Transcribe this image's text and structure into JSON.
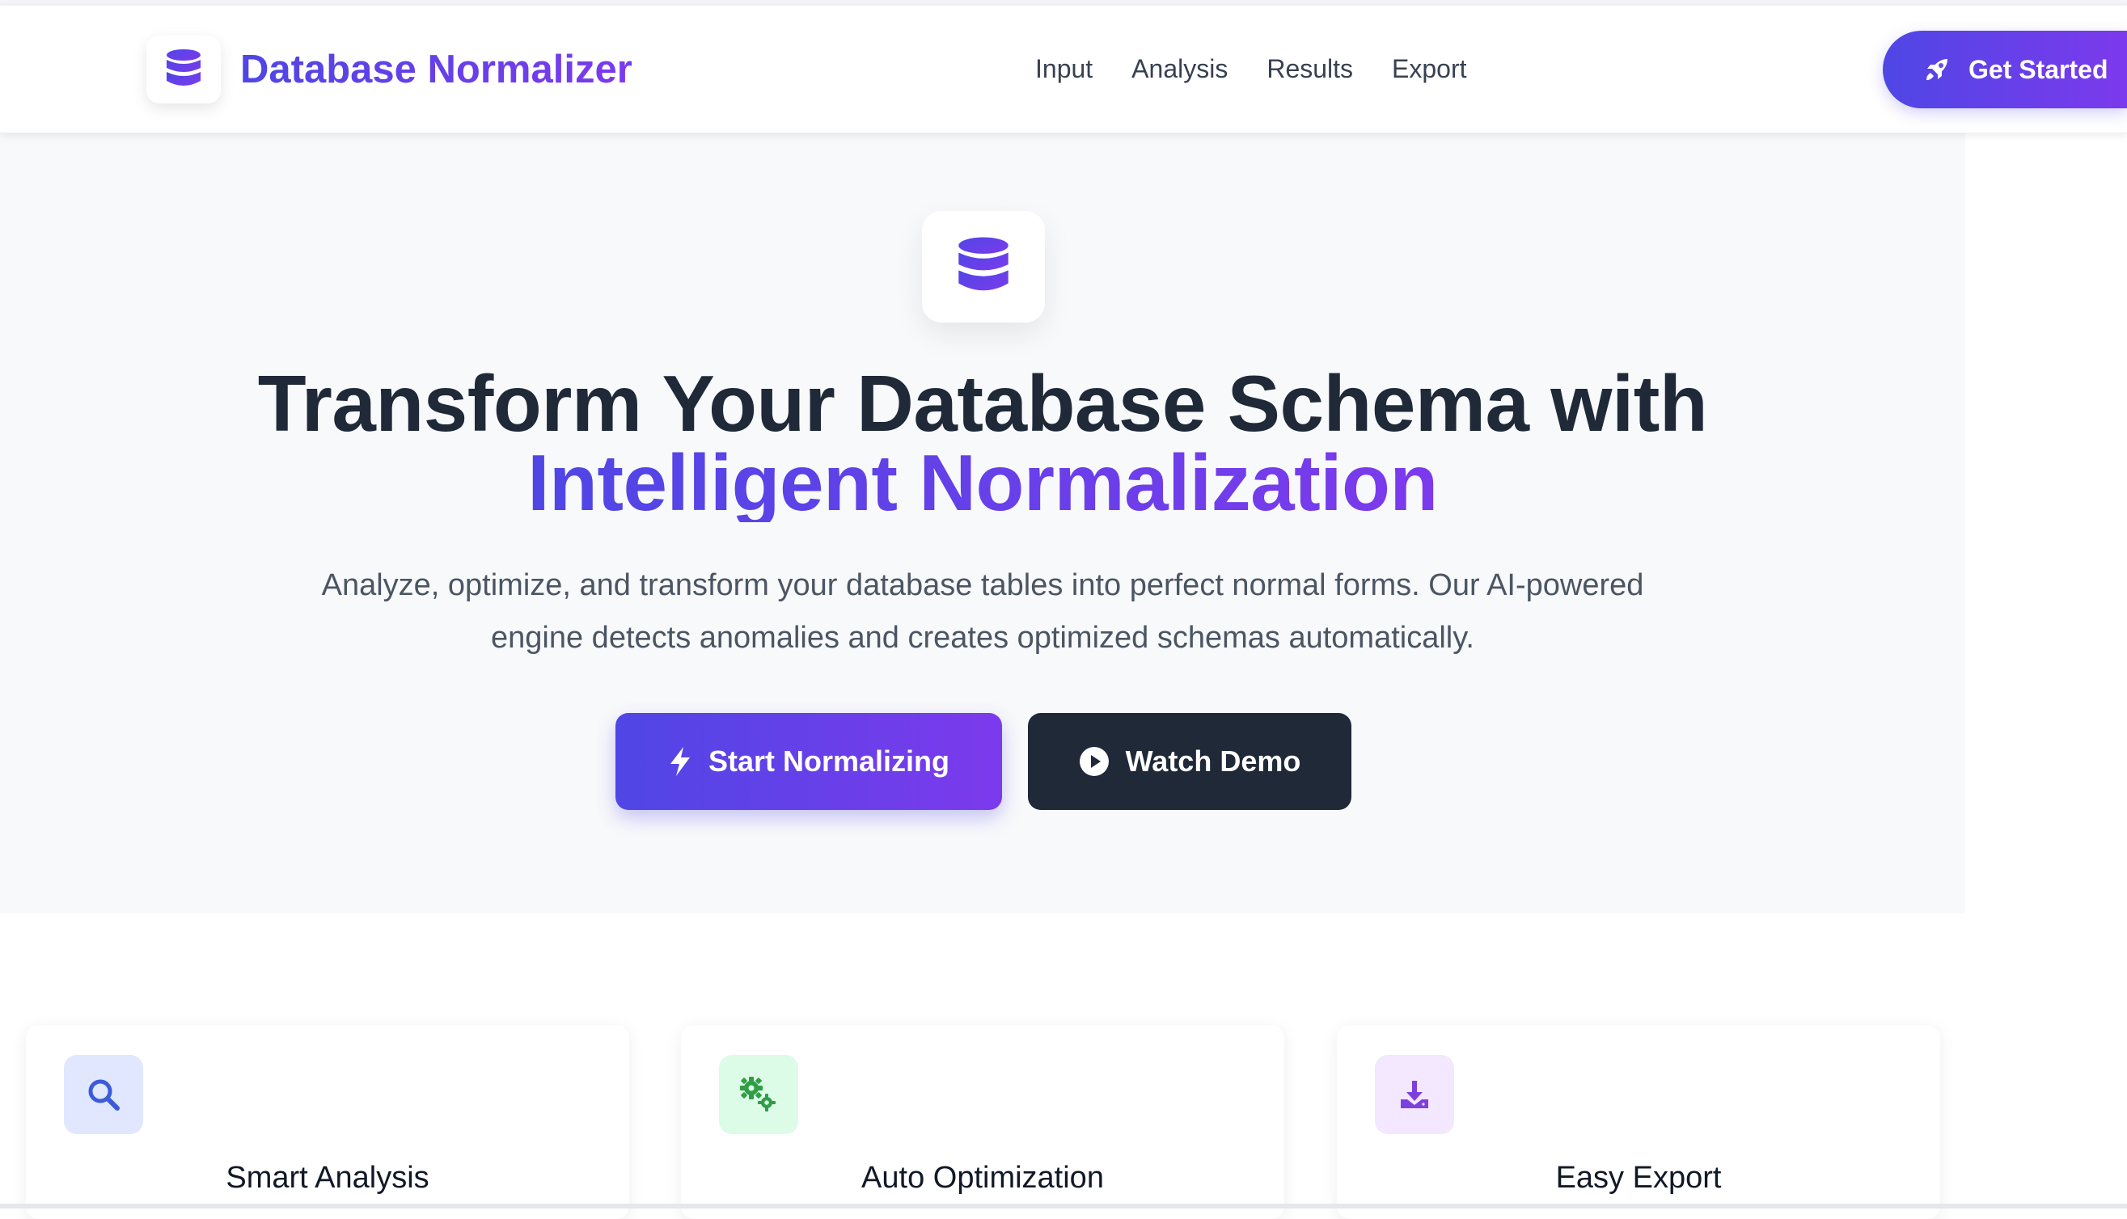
{
  "brand": {
    "name": "Database Normalizer",
    "icon": "database-icon"
  },
  "nav": {
    "links": [
      "Input",
      "Analysis",
      "Results",
      "Export"
    ],
    "cta_label": "Get Started",
    "cta_icon": "rocket-icon"
  },
  "hero": {
    "icon": "database-icon",
    "title_line1": "Transform Your Database Schema with",
    "title_line2": "Intelligent Normalization",
    "subtitle_line1": "Analyze, optimize, and transform your database tables into perfect normal forms. Our AI-powered",
    "subtitle_line2": "engine detects anomalies and creates optimized schemas automatically.",
    "primary_button": {
      "label": "Start Normalizing",
      "icon": "bolt-icon"
    },
    "secondary_button": {
      "label": "Watch Demo",
      "icon": "play-circle-icon"
    }
  },
  "features": [
    {
      "title": "Smart Analysis",
      "icon": "search-icon",
      "icon_color": "#3b5bdb",
      "icon_bg": "#e0e7ff"
    },
    {
      "title": "Auto Optimization",
      "icon": "gears-icon",
      "icon_color": "#2f9e44",
      "icon_bg": "#dcfce7"
    },
    {
      "title": "Easy Export",
      "icon": "download-icon",
      "icon_color": "#7e3fe0",
      "icon_bg": "#f3e8ff"
    }
  ],
  "colors": {
    "accent_start": "#4f46e5",
    "accent_end": "#7c3aed",
    "dark_button": "#1f2937",
    "hero_bg": "#f8f9fb"
  }
}
